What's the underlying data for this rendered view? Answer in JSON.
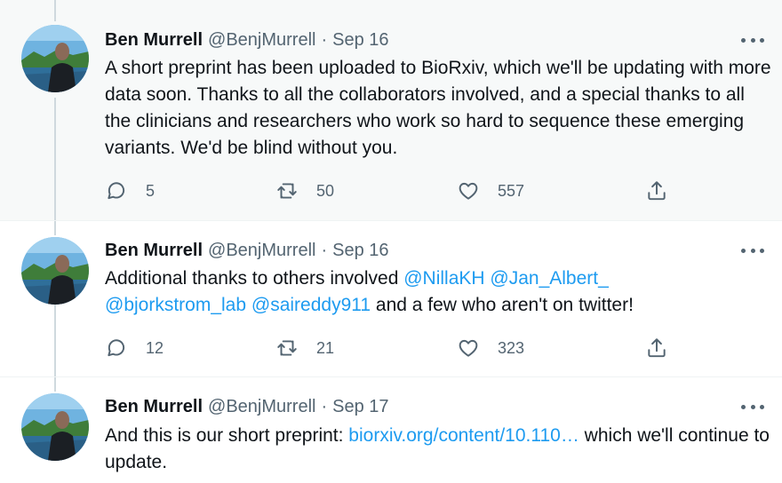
{
  "tweets": [
    {
      "name": "Ben Murrell",
      "handle": "@BenjMurrell",
      "separator": "·",
      "date": "Sep 16",
      "text": "A short preprint has been uploaded to BioRxiv, which we'll be updating with more data soon. Thanks to all the collaborators involved, and a special thanks to all the clinicians and researchers who work so hard to sequence these emerging variants. We'd be blind without you.",
      "replies": "5",
      "retweets": "50",
      "likes": "557"
    },
    {
      "name": "Ben Murrell",
      "handle": "@BenjMurrell",
      "separator": "·",
      "date": "Sep 16",
      "text_prefix": "Additional thanks to others involved ",
      "mentions": [
        "@NillaKH",
        "@Jan_Albert_",
        "@bjorkstrom_lab",
        "@saireddy911"
      ],
      "text_suffix": " and a few who aren't on twitter!",
      "replies": "12",
      "retweets": "21",
      "likes": "323"
    },
    {
      "name": "Ben Murrell",
      "handle": "@BenjMurrell",
      "separator": "·",
      "date": "Sep 17",
      "text_prefix": "And this is our short preprint: ",
      "link": "biorxiv.org/content/10.110…",
      "text_suffix": " which we'll continue to update."
    }
  ],
  "icons": {
    "reply": "reply-icon",
    "retweet": "retweet-icon",
    "like": "heart-icon",
    "share": "share-icon",
    "more": "more-icon"
  },
  "colors": {
    "accent": "#1d9bf0",
    "secondary_text": "#536471",
    "highlight_bg": "#f7f9f9",
    "thread_line": "#cfd9de"
  }
}
